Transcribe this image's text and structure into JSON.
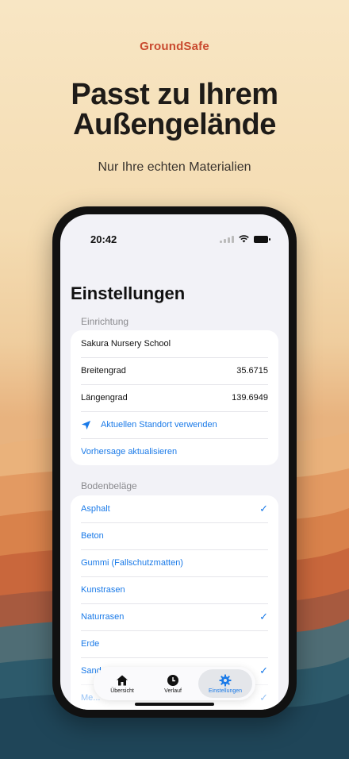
{
  "brand": "GroundSafe",
  "headline_line1": "Passt zu Ihrem",
  "headline_line2": "Außengelände",
  "subline": "Nur Ihre echten Materialien",
  "status": {
    "time": "20:42"
  },
  "screen_title": "Einstellungen",
  "setup": {
    "section": "Einrichtung",
    "facility": "Sakura Nursery School",
    "latitude_label": "Breitengrad",
    "latitude_value": "35.6715",
    "longitude_label": "Längengrad",
    "longitude_value": "139.6949",
    "use_location": "Aktuellen Standort verwenden",
    "refresh_forecast": "Vorhersage aktualisieren"
  },
  "surfaces": {
    "section": "Bodenbeläge",
    "items": [
      {
        "label": "Asphalt",
        "checked": true
      },
      {
        "label": "Beton",
        "checked": false
      },
      {
        "label": "Gummi (Fallschutzmatten)",
        "checked": false
      },
      {
        "label": "Kunstrasen",
        "checked": false
      },
      {
        "label": "Naturrasen",
        "checked": true
      },
      {
        "label": "Erde",
        "checked": false
      },
      {
        "label": "Sand",
        "checked": true
      },
      {
        "label": "Me...",
        "checked": true
      }
    ]
  },
  "tabs": [
    {
      "label": "Übersicht",
      "icon": "house-icon",
      "active": false
    },
    {
      "label": "Verlauf",
      "icon": "clock-icon",
      "active": false
    },
    {
      "label": "Einstellungen",
      "icon": "gear-icon",
      "active": true
    }
  ],
  "colors": {
    "accent": "#1a7ae8",
    "brand": "#c94a2f"
  }
}
